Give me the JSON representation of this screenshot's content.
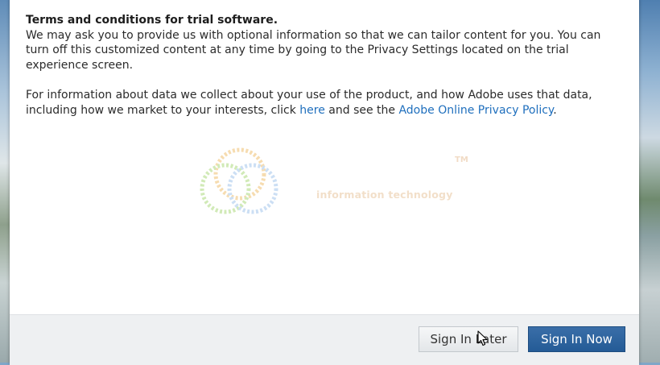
{
  "terms": {
    "heading": "Terms and conditions for trial software.",
    "paragraph1": "We may ask you to provide us with optional information so that we can tailor content for you. You can turn off this customized content at any time by going to the Privacy Settings located on the trial experience screen.",
    "paragraph2_prefix": "For information about data we collect about your use of the product, and how Adobe uses that data, including how we market to your interests, click ",
    "here_link": "here",
    "paragraph2_middle": " and see the ",
    "privacy_link": "Adobe Online Privacy Policy",
    "paragraph2_suffix": "."
  },
  "watermark": {
    "tagline": "information technology",
    "trademark": "TM"
  },
  "footer": {
    "sign_in_later_label": "Sign In Later",
    "sign_in_now_label": "Sign In Now"
  },
  "colors": {
    "link": "#1f6fbd",
    "primary_button": "#245b96",
    "footer_bg": "#eef0f2"
  }
}
